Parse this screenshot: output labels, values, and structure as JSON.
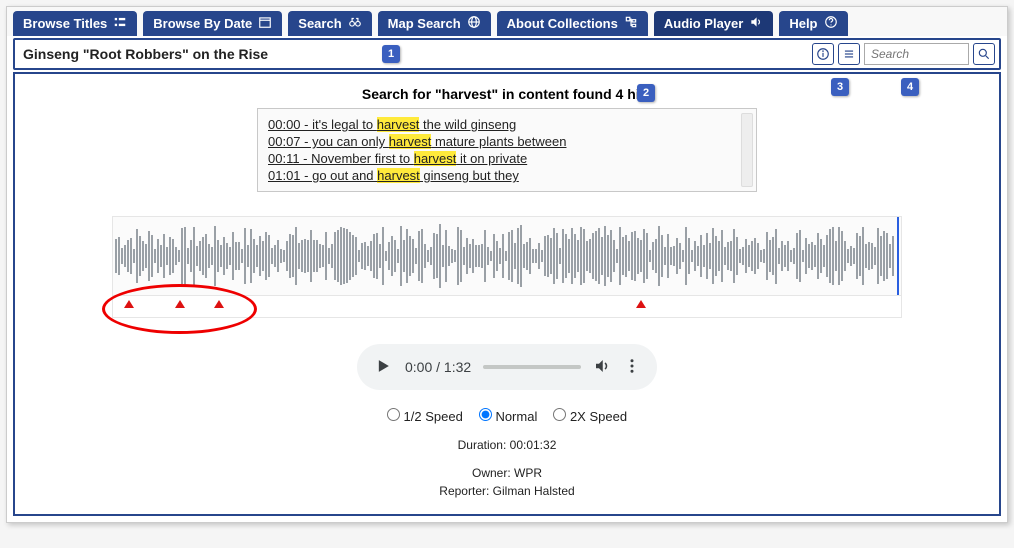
{
  "nav": {
    "tabs": [
      {
        "label": "Browse Titles",
        "icon": "list"
      },
      {
        "label": "Browse By Date",
        "icon": "calendar"
      },
      {
        "label": "Search",
        "icon": "binoculars"
      },
      {
        "label": "Map Search",
        "icon": "globe"
      },
      {
        "label": "About Collections",
        "icon": "tree"
      },
      {
        "label": "Audio Player",
        "icon": "sound",
        "active": true
      },
      {
        "label": "Help",
        "icon": "help"
      }
    ]
  },
  "titlebar": {
    "title": "Ginseng \"Root Robbers\" on the Rise",
    "search_placeholder": "Search"
  },
  "callouts": {
    "c1": "1",
    "c2": "2",
    "c3": "3",
    "c4": "4"
  },
  "search_results": {
    "heading": "Search for \"harvest\" in content found 4 hits",
    "highlight_term": "harvest",
    "hits": [
      {
        "time": "00:00",
        "before": "it's legal to ",
        "after": " the wild ginseng"
      },
      {
        "time": "00:07",
        "before": "you can only ",
        "after": " mature plants between"
      },
      {
        "time": "00:11",
        "before": "November first to ",
        "after": " it on private"
      },
      {
        "time": "01:01",
        "before": "go out and ",
        "after": " ginseng but they"
      }
    ]
  },
  "markers_pct": [
    2,
    8.5,
    13.5,
    67
  ],
  "player": {
    "time_current": "0:00",
    "time_total": "1:32"
  },
  "speed": {
    "options": [
      {
        "label": "1/2 Speed",
        "value": "half"
      },
      {
        "label": "Normal",
        "value": "normal",
        "checked": true
      },
      {
        "label": "2X Speed",
        "value": "double"
      }
    ]
  },
  "meta": {
    "duration": "Duration: 00:01:32",
    "owner": "Owner: WPR",
    "reporter": "Reporter: Gilman Halsted"
  }
}
